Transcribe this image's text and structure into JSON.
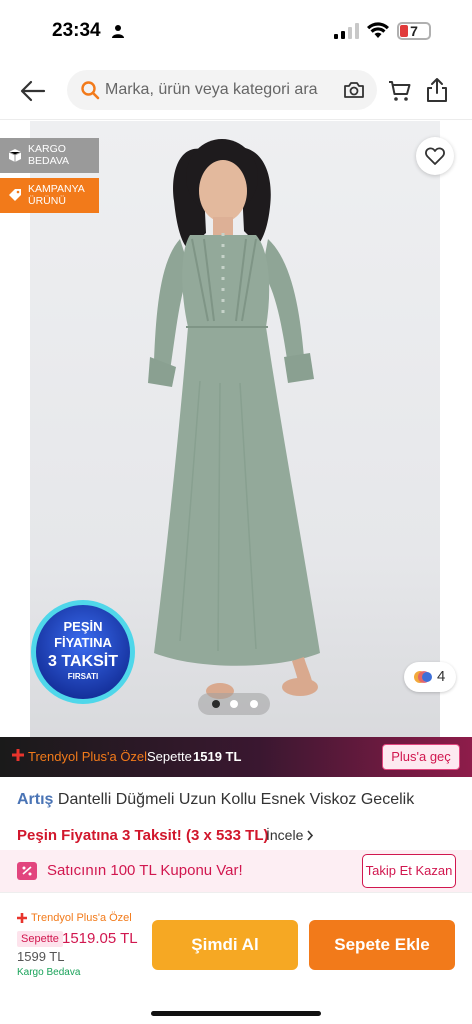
{
  "status_bar": {
    "time": "23:34",
    "battery": "7"
  },
  "search": {
    "placeholder": "Marka, ürün veya kategori ara"
  },
  "hero": {
    "badges": {
      "cargo": "KARGO\nBEDAVA",
      "campaign": "KAMPANYA\nÜRÜNÜ"
    },
    "promo_circle": {
      "line1": "PEŞİN",
      "line2": "FİYATINA",
      "line3": "3 TAKSİT",
      "line4": "FIRSATI"
    },
    "color_count": "4",
    "pager": {
      "pages": 3,
      "active": 1
    }
  },
  "plus_bar": {
    "label": "Trendyol Plus'a Özel",
    "basket_text": "Sepette",
    "price": "1519 TL",
    "button": "Plus'a geç"
  },
  "product": {
    "brand": "Artış",
    "name": "Dantelli Düğmeli Uzun Kollu Esnek Viskoz Gecelik",
    "installment": "Peşin Fiyatına 3 Taksit! (3 x 533 TL)",
    "review_link": "İncele"
  },
  "coupon": {
    "text": "Satıcının 100 TL Kuponu Var!",
    "button": "Takip Et Kazan"
  },
  "footer": {
    "plus_label": "Trendyol Plus'a Özel",
    "basket_tag": "Sepette",
    "plus_price": "1519.05 TL",
    "old_price": "1599 TL",
    "cargo": "Kargo Bedava",
    "buy_button": "Şimdi Al",
    "cart_button": "Sepete Ekle"
  },
  "colors": {
    "accent": "#f27a1a",
    "plus_pink": "#d1174f",
    "brand_blue": "#4a74b5"
  }
}
